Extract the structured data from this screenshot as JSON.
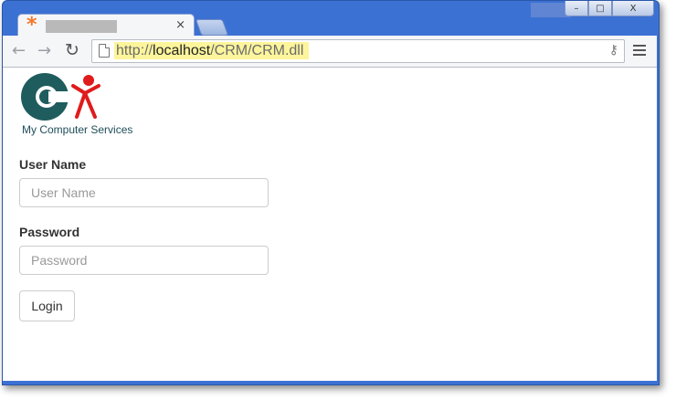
{
  "window": {
    "controls": {
      "minimize": "–",
      "maximize": "□",
      "close": "X"
    }
  },
  "tab": {
    "close_glyph": "×"
  },
  "toolbar": {
    "back_glyph": "←",
    "forward_glyph": "→",
    "reload_glyph": "↻",
    "url_scheme": "http://",
    "url_host": "localhost",
    "url_path": "/CRM/CRM.dll",
    "key_glyph": "⚷"
  },
  "page": {
    "logo_caption": "My Computer Services",
    "username_label": "User Name",
    "username_placeholder": "User Name",
    "username_value": "",
    "password_label": "Password",
    "password_placeholder": "Password",
    "password_value": "",
    "login_label": "Login"
  },
  "colors": {
    "frame": "#3c71d4",
    "url_highlight": "#fdf59c",
    "logo_teal": "#1f5c5e",
    "logo_red": "#e01b1b",
    "favicon": "#f4782a"
  }
}
